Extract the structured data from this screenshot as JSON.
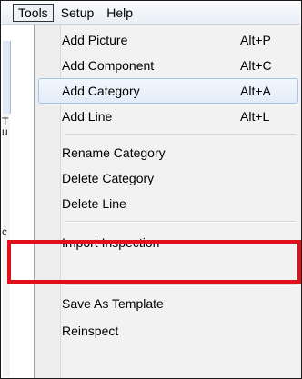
{
  "menubar": {
    "items": [
      "Tools",
      "Setup",
      "Help"
    ]
  },
  "background": {
    "fragments": [
      "T",
      "u",
      "c"
    ]
  },
  "menu": {
    "items": [
      {
        "label": "Add Picture",
        "shortcut": "Alt+P"
      },
      {
        "label": "Add Component",
        "shortcut": "Alt+C"
      },
      {
        "label": "Add Category",
        "shortcut": "Alt+A",
        "highlighted": true
      },
      {
        "label": "Add Line",
        "shortcut": "Alt+L"
      },
      {
        "label": "Rename Category"
      },
      {
        "label": "Delete Category"
      },
      {
        "label": "Delete Line"
      },
      {
        "label": "Import Inspection",
        "annotated": true
      },
      {
        "label": "Save As Template"
      },
      {
        "label": "Reinspect"
      }
    ]
  },
  "colors": {
    "annotation": "#e0101a",
    "hover_border": "#a8c4e6",
    "menu_bg": "#f2f2f2"
  }
}
